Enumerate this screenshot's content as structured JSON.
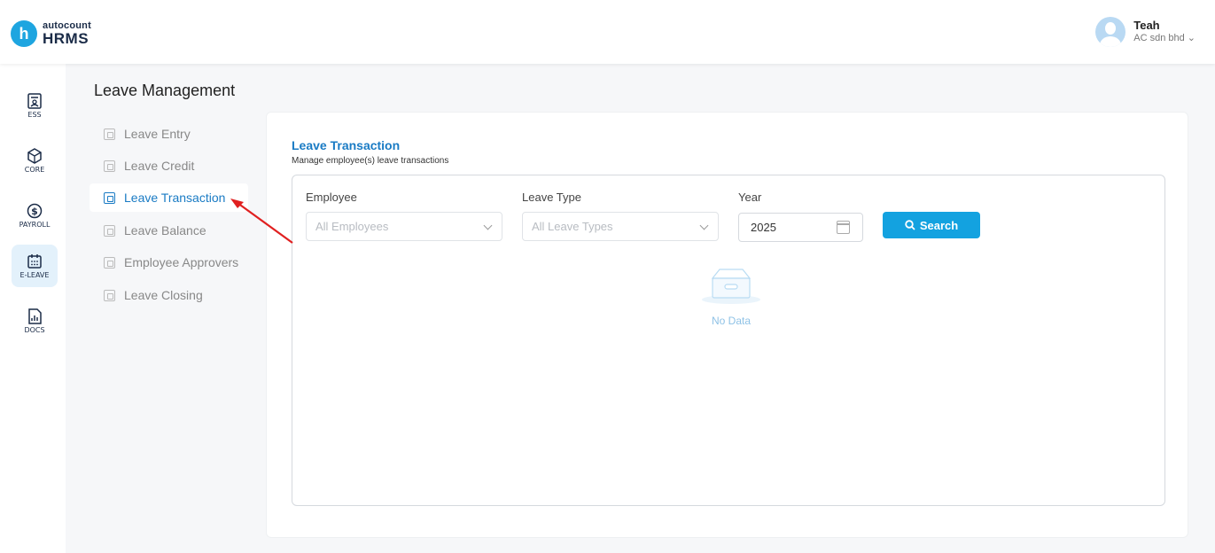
{
  "brand": {
    "logo_letter": "h",
    "name_top": "autocount",
    "name_bottom": "HRMS"
  },
  "user": {
    "name": "Teah",
    "company": "AC sdn bhd"
  },
  "iconbar": [
    {
      "label": "ESS",
      "icon": "ess-icon"
    },
    {
      "label": "CORE",
      "icon": "core-icon"
    },
    {
      "label": "PAYROLL",
      "icon": "payroll-icon"
    },
    {
      "label": "E-LEAVE",
      "icon": "calendar-icon",
      "active": true
    },
    {
      "label": "DOCS",
      "icon": "docs-icon"
    }
  ],
  "module": {
    "title": "Leave Management",
    "menu": [
      {
        "label": "Leave Entry"
      },
      {
        "label": "Leave Credit"
      },
      {
        "label": "Leave Transaction",
        "active": true
      },
      {
        "label": "Leave Balance"
      },
      {
        "label": "Employee Approvers"
      },
      {
        "label": "Leave Closing"
      }
    ]
  },
  "panel": {
    "title": "Leave Transaction",
    "subtitle": "Manage employee(s) leave transactions",
    "filters": {
      "employee_label": "Employee",
      "employee_placeholder": "All Employees",
      "leave_type_label": "Leave Type",
      "leave_type_placeholder": "All Leave Types",
      "year_label": "Year",
      "year_value": "2025",
      "search_label": "Search"
    },
    "empty_text": "No Data"
  },
  "colors": {
    "accent": "#13a2e0",
    "link": "#1a7bc4",
    "annotation_arrow": "#e02020"
  }
}
